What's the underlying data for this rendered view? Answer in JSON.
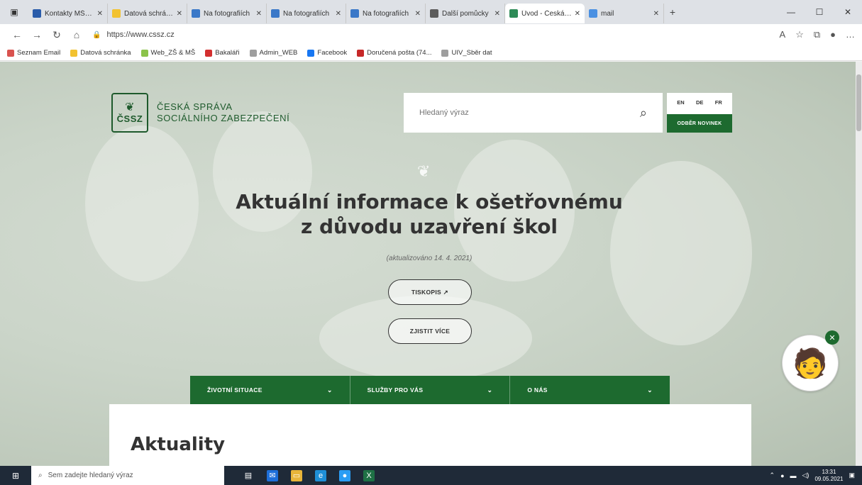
{
  "browser": {
    "tabs": [
      {
        "title": "Kontakty MŠMT",
        "color": "#2a5caa"
      },
      {
        "title": "Datová schránka",
        "color": "#f2c230"
      },
      {
        "title": "Na fotografiích",
        "color": "#3a78c8"
      },
      {
        "title": "Na fotografiích",
        "color": "#3a78c8"
      },
      {
        "title": "Na fotografiích",
        "color": "#3a78c8"
      },
      {
        "title": "Další pomůcky",
        "color": "#5c5c5c"
      },
      {
        "title": "Úvod - Česká spr",
        "color": "#2e8b57",
        "active": true
      },
      {
        "title": "mail",
        "color": "#4a90e2"
      }
    ],
    "url": "https://www.cssz.cz",
    "bookmarks": [
      {
        "label": "Seznam Email",
        "color": "#d9534f"
      },
      {
        "label": "Datová schránka",
        "color": "#f2c230"
      },
      {
        "label": "Web_ZŠ & MŠ",
        "color": "#8bc34a"
      },
      {
        "label": "Bakaláři",
        "color": "#d32f2f"
      },
      {
        "label": "Admin_WEB",
        "color": "#9e9e9e"
      },
      {
        "label": "Facebook",
        "color": "#1877f2"
      },
      {
        "label": "Doručená pošta (74...",
        "color": "#c62828"
      },
      {
        "label": "UIV_Sběr dat",
        "color": "#9e9e9e"
      }
    ]
  },
  "site": {
    "logo_abbr": "ČSSZ",
    "logo_line1": "ČESKÁ SPRÁVA",
    "logo_line2": "SOCIÁLNÍHO ZABEZPEČENÍ",
    "search_placeholder": "Hledaný výraz",
    "langs": [
      "EN",
      "DE",
      "FR"
    ],
    "subscribe_label": "ODBĚR NOVINEK",
    "hero_title_line1": "Aktuální informace k ošetřovnému",
    "hero_title_line2": "z důvodu uzavření škol",
    "hero_date": "(aktualizováno 14. 4. 2021)",
    "btn_form": "TISKOPIS",
    "btn_more": "ZJISTIT VÍCE",
    "nav": [
      "ŽIVOTNÍ SITUACE",
      "SLUŽBY PRO VÁS",
      "O NÁS"
    ],
    "news_heading": "Aktuality"
  },
  "taskbar": {
    "search_placeholder": "Sem zadejte hledaný výraz",
    "time": "13:31",
    "date": "09.05.2021"
  },
  "colors": {
    "brand_green": "#1d6a2f"
  }
}
